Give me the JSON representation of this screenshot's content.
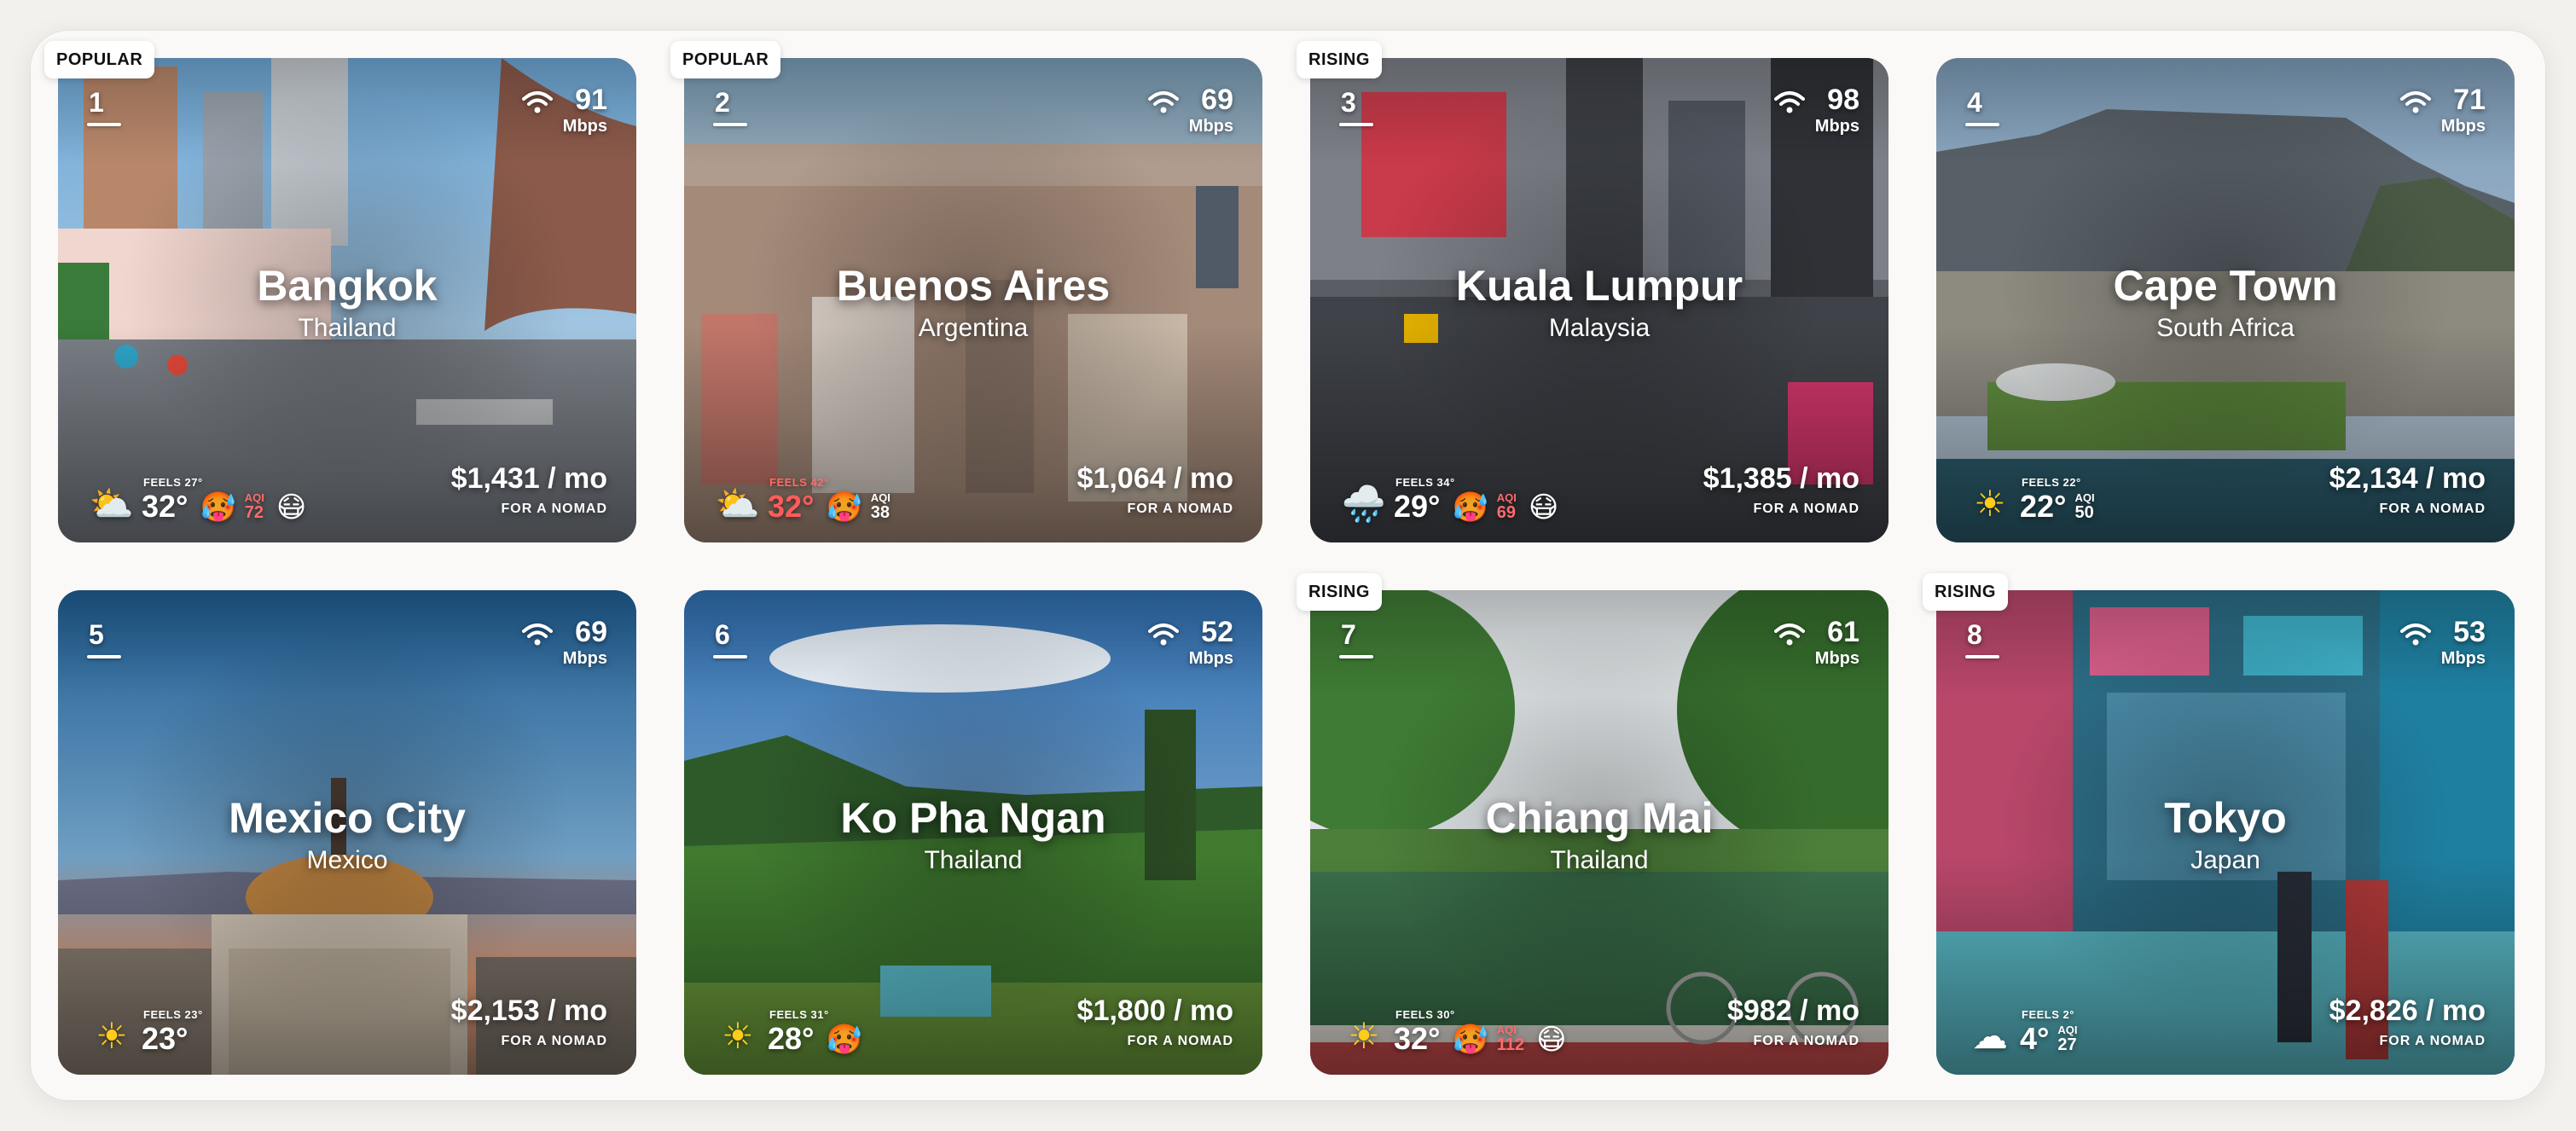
{
  "labels": {
    "per_month": " / mo",
    "for_nomad": "FOR A NOMAD",
    "mbps": "Mbps",
    "aqi": "AQI"
  },
  "cities": [
    {
      "rank": "1",
      "badge": "POPULAR",
      "name": "Bangkok",
      "country": "Thailand",
      "mbps": "91",
      "cost": "$1,431 / mo",
      "weather_icon": "partly-cloudy-icon",
      "temp": "32°",
      "feels": "FEELS 27°",
      "temp_hot": false,
      "emojis": "🥵",
      "emoji2": "😷",
      "aqi": "72",
      "aqi_bad": true
    },
    {
      "rank": "2",
      "badge": "POPULAR",
      "name": "Buenos Aires",
      "country": "Argentina",
      "mbps": "69",
      "cost": "$1,064 / mo",
      "weather_icon": "partly-cloudy-icon",
      "temp": "32°",
      "feels": "FEELS 42°",
      "temp_hot": true,
      "emojis": "🥵",
      "emoji2": "",
      "aqi": "38",
      "aqi_bad": false
    },
    {
      "rank": "3",
      "badge": "RISING",
      "name": "Kuala Lumpur",
      "country": "Malaysia",
      "mbps": "98",
      "cost": "$1,385 / mo",
      "weather_icon": "rain-cloud-icon",
      "temp": "29°",
      "feels": "FEELS 34°",
      "temp_hot": false,
      "emojis": "🥵",
      "emoji2": "😷",
      "aqi": "69",
      "aqi_bad": true
    },
    {
      "rank": "4",
      "badge": "",
      "name": "Cape Town",
      "country": "South Africa",
      "mbps": "71",
      "cost": "$2,134 / mo",
      "weather_icon": "sun-icon",
      "temp": "22°",
      "feels": "FEELS 22°",
      "temp_hot": false,
      "emojis": "",
      "emoji2": "",
      "aqi": "50",
      "aqi_bad": false
    },
    {
      "rank": "5",
      "badge": "",
      "name": "Mexico City",
      "country": "Mexico",
      "mbps": "69",
      "cost": "$2,153 / mo",
      "weather_icon": "sun-icon",
      "temp": "23°",
      "feels": "FEELS 23°",
      "temp_hot": false,
      "emojis": "",
      "emoji2": "",
      "aqi": "",
      "aqi_bad": false
    },
    {
      "rank": "6",
      "badge": "",
      "name": "Ko Pha Ngan",
      "country": "Thailand",
      "mbps": "52",
      "cost": "$1,800 / mo",
      "weather_icon": "sun-icon",
      "temp": "28°",
      "feels": "FEELS 31°",
      "temp_hot": false,
      "emojis": "🥵",
      "emoji2": "",
      "aqi": "",
      "aqi_bad": false
    },
    {
      "rank": "7",
      "badge": "RISING",
      "name": "Chiang Mai",
      "country": "Thailand",
      "mbps": "61",
      "cost": "$982 / mo",
      "weather_icon": "sun-icon",
      "temp": "32°",
      "feels": "FEELS 30°",
      "temp_hot": false,
      "emojis": "🥵",
      "emoji2": "😷",
      "aqi": "112",
      "aqi_bad": true
    },
    {
      "rank": "8",
      "badge": "RISING",
      "name": "Tokyo",
      "country": "Japan",
      "mbps": "53",
      "cost": "$2,826 / mo",
      "weather_icon": "cloud-icon",
      "temp": "4°",
      "feels": "FEELS 2°",
      "temp_hot": false,
      "emojis": "",
      "emoji2": "",
      "aqi": "27",
      "aqi_bad": false
    }
  ],
  "colors": {
    "page_bg": "#f3f1ee",
    "panel_bg": "#faf9f7",
    "badge_bg": "#ffffff",
    "hot_text": "#ff5c5c"
  }
}
